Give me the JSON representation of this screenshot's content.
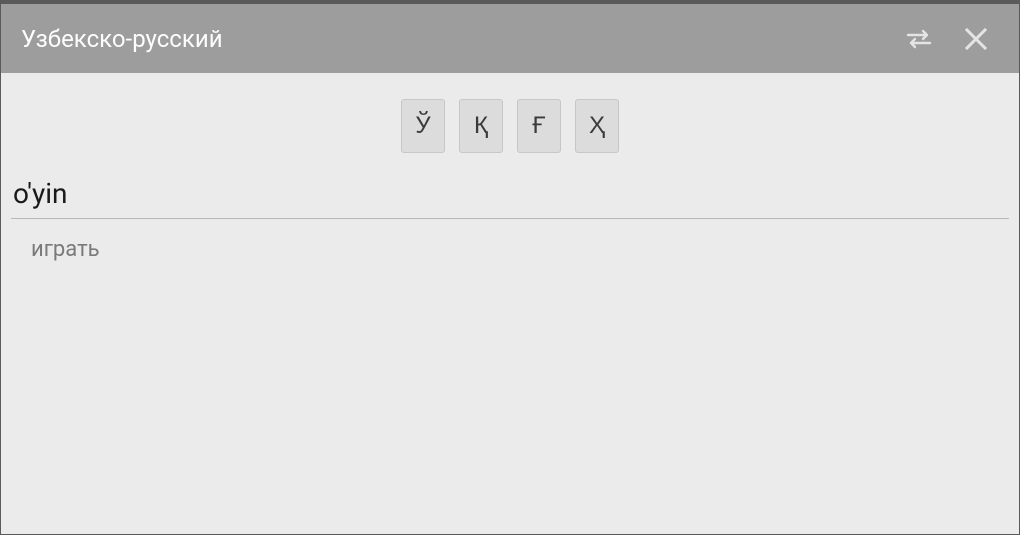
{
  "header": {
    "title": "Узбекско-русский"
  },
  "char_keys": [
    "Ў",
    "Қ",
    "Ғ",
    "Ҳ"
  ],
  "search": {
    "value": "o'yin"
  },
  "result": {
    "text": "играть"
  }
}
